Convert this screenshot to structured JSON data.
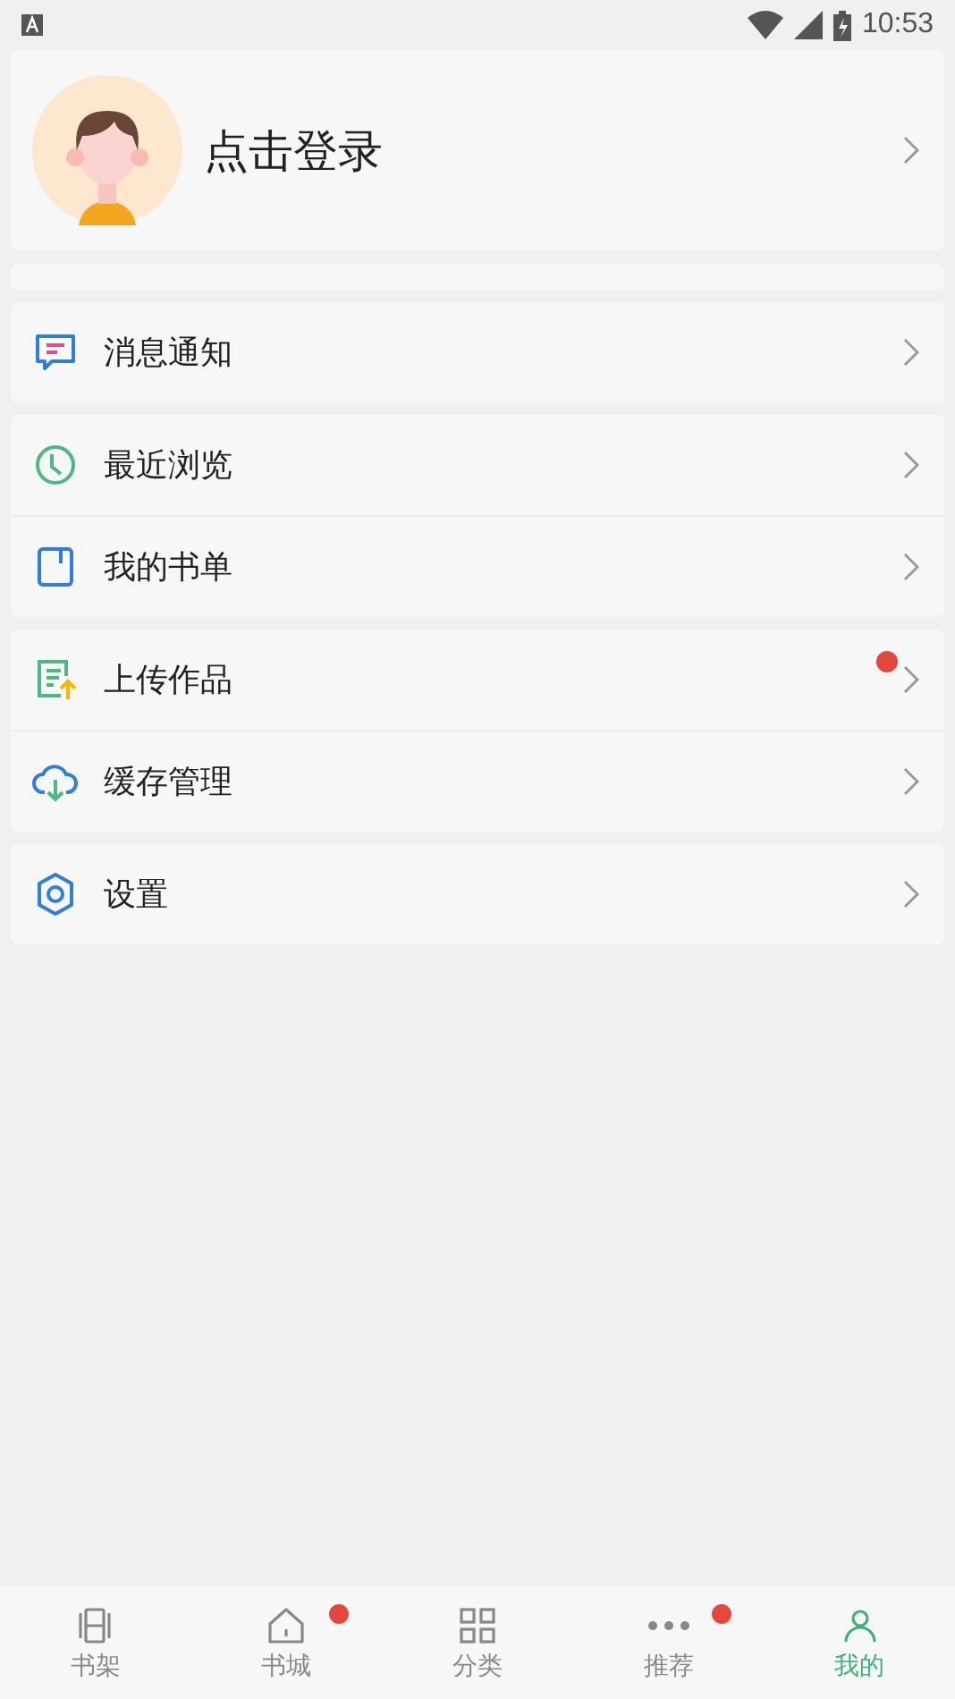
{
  "status_bar": {
    "time": "10:53"
  },
  "profile": {
    "login_label": "点击登录"
  },
  "menu_groups": [
    {
      "items": [
        {
          "label": "消息通知",
          "badge": false
        }
      ]
    },
    {
      "items": [
        {
          "label": "最近浏览",
          "badge": false
        },
        {
          "label": "我的书单",
          "badge": false
        }
      ]
    },
    {
      "items": [
        {
          "label": "上传作品",
          "badge": true
        },
        {
          "label": "缓存管理",
          "badge": false
        }
      ]
    },
    {
      "items": [
        {
          "label": "设置",
          "badge": false
        }
      ]
    }
  ],
  "tab_bar": [
    {
      "label": "书架",
      "selected": false,
      "badge": false
    },
    {
      "label": "书城",
      "selected": false,
      "badge": true
    },
    {
      "label": "分类",
      "selected": false,
      "badge": false
    },
    {
      "label": "推荐",
      "selected": false,
      "badge": true
    },
    {
      "label": "我的",
      "selected": true,
      "badge": false
    }
  ]
}
